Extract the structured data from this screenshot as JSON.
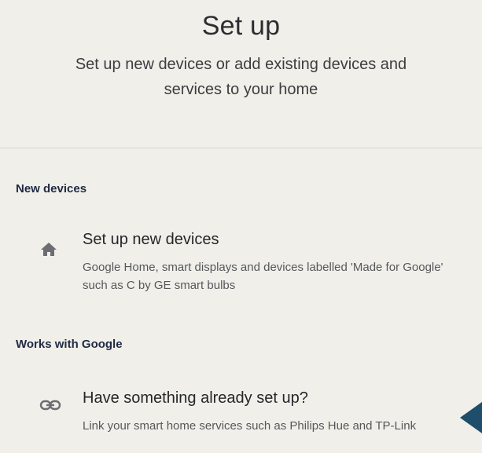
{
  "header": {
    "title": "Set up",
    "subtitle": "Set up new devices or add existing devices and services to your home"
  },
  "sections": [
    {
      "label": "New devices",
      "item": {
        "icon": "home-icon",
        "title": "Set up new devices",
        "description": "Google Home, smart displays and devices labelled 'Made for Google' such as C by GE smart bulbs"
      }
    },
    {
      "label": "Works with Google",
      "item": {
        "icon": "link-icon",
        "title": "Have something already set up?",
        "description": "Link your smart home services such as Philips Hue and TP-Link"
      }
    }
  ],
  "colors": {
    "background": "#f1efe9",
    "section_label": "#1f2a44",
    "pointer": "#1f4e6a"
  }
}
